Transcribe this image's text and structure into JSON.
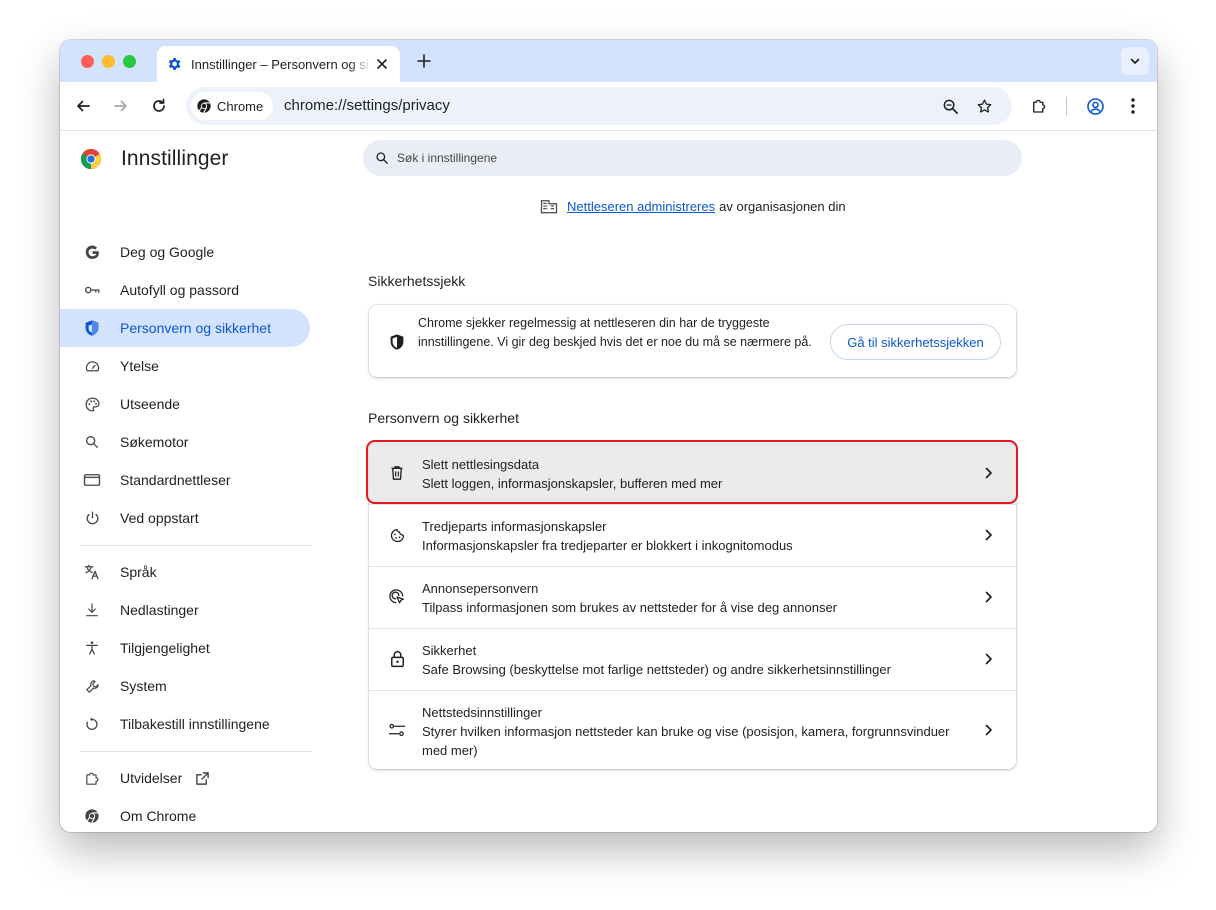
{
  "tab": {
    "title": "Innstillinger – Personvern og sikkerhet"
  },
  "toolbar": {
    "chip_label": "Chrome",
    "url": "chrome://settings/privacy"
  },
  "sidebar": {
    "title": "Innstillinger",
    "items": [
      {
        "label": "Deg og Google",
        "icon": "google-icon"
      },
      {
        "label": "Autofyll og passord",
        "icon": "key-icon"
      },
      {
        "label": "Personvern og sikkerhet",
        "icon": "shield-icon",
        "active": true
      },
      {
        "label": "Ytelse",
        "icon": "speedometer-icon"
      },
      {
        "label": "Utseende",
        "icon": "palette-icon"
      },
      {
        "label": "Søkemotor",
        "icon": "search-icon"
      },
      {
        "label": "Standardnettleser",
        "icon": "browser-window-icon"
      },
      {
        "label": "Ved oppstart",
        "icon": "power-icon"
      },
      {
        "label": "Språk",
        "icon": "translate-icon"
      },
      {
        "label": "Nedlastinger",
        "icon": "download-icon"
      },
      {
        "label": "Tilgjengelighet",
        "icon": "accessibility-icon"
      },
      {
        "label": "System",
        "icon": "wrench-icon"
      },
      {
        "label": "Tilbakestill innstillingene",
        "icon": "reset-icon"
      },
      {
        "label": "Utvidelser",
        "icon": "puzzle-icon"
      },
      {
        "label": "Om Chrome",
        "icon": "chrome-icon"
      }
    ]
  },
  "search": {
    "placeholder": "Søk i innstillingene"
  },
  "managed": {
    "link": "Nettleseren administreres",
    "rest": "av organisasjonen din"
  },
  "safety_check": {
    "heading": "Sikkerhetssjekk",
    "text": "Chrome sjekker regelmessig at nettleseren din har de tryggeste innstillingene. Vi gir deg beskjed hvis det er noe du må se nærmere på.",
    "button": "Gå til sikkerhetssjekken"
  },
  "privacy": {
    "heading": "Personvern og sikkerhet",
    "rows": [
      {
        "title": "Slett nettlesingsdata",
        "subtitle": "Slett loggen, informasjonskapsler, bufferen med mer",
        "icon": "trash-icon",
        "highlighted": true
      },
      {
        "title": "Tredjeparts informasjonskapsler",
        "subtitle": "Informasjonskapsler fra tredjeparter er blokkert i inkognitomodus",
        "icon": "cookie-icon"
      },
      {
        "title": "Annonsepersonvern",
        "subtitle": "Tilpass informasjonen som brukes av nettsteder for å vise deg annonser",
        "icon": "ad-privacy-icon"
      },
      {
        "title": "Sikkerhet",
        "subtitle": "Safe Browsing (beskyttelse mot farlige nettsteder) og andre sikkerhetsinnstillinger",
        "icon": "lock-icon"
      },
      {
        "title": "Nettstedsinnstillinger",
        "subtitle": "Styrer hvilken informasjon nettsteder kan bruke og vise (posisjon, kamera, forgrunnsvinduer med mer)",
        "icon": "sliders-icon"
      }
    ]
  },
  "colors": {
    "accent": "#0b57d0",
    "tabstrip": "#d3e3fd",
    "active_nav": "#d3e3fd",
    "highlight_border": "#e8171b"
  }
}
